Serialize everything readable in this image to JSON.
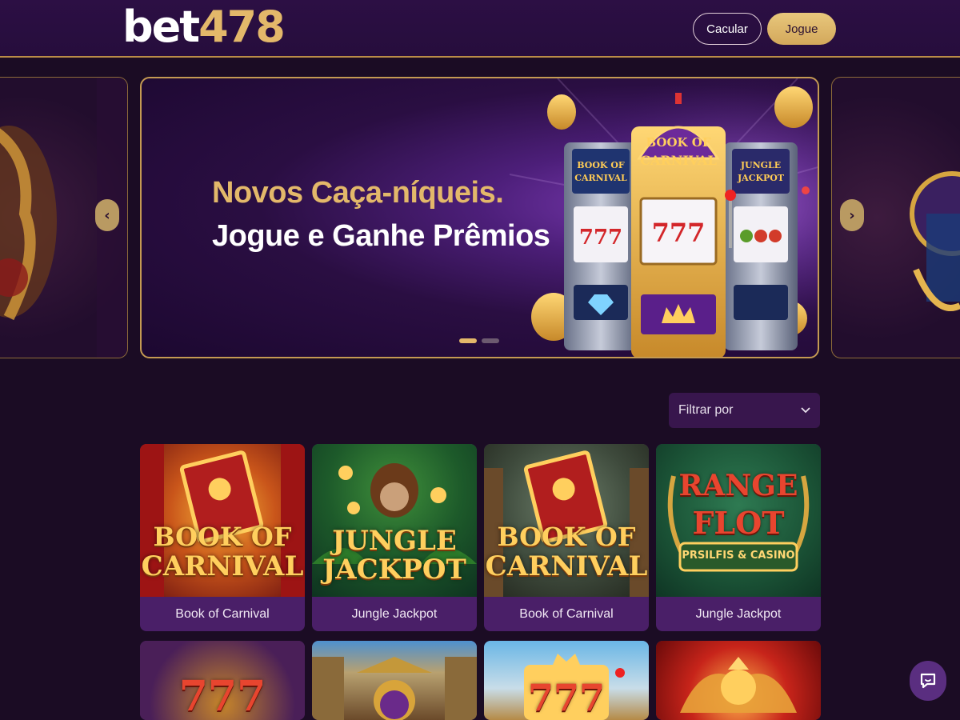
{
  "header": {
    "logo_part1": "bet",
    "logo_part2": "478",
    "login_label": "Cacular",
    "play_label": "Jogue"
  },
  "banner": {
    "title_line1": "Novos Caça-níqueis.",
    "title_line2": "Jogue e Ganhe Prêmios",
    "machine_left_label": "BOOK OF CARNIVAL",
    "machine_center_label_1": "BOOK OF",
    "machine_center_label_2": "CARNIVAL",
    "machine_right_label": "JUNGLE JACKPOT",
    "reel_symbols": "777",
    "active_slide_index": 0,
    "slide_count": 2
  },
  "filter": {
    "label": "Filtrar por"
  },
  "games": [
    {
      "name": "Book of Carnival",
      "art_line1": "BOOK OF",
      "art_line2": "CARNIVAL",
      "theme": "carnival"
    },
    {
      "name": "Jungle Jackpot",
      "art_line1": "JUNGLE",
      "art_line2": "JACKPOT",
      "theme": "jungle"
    },
    {
      "name": "Book of Carnival",
      "art_line1": "BOOK OF",
      "art_line2": "CARNIVAL",
      "theme": "carnival2"
    },
    {
      "name": "Jungle Jackpot",
      "art_line1": "RANGE",
      "art_line2": "FLOT",
      "art_line3": "PRSILFIS & CASINO",
      "theme": "range"
    }
  ],
  "games_row2": [
    {
      "art_text": "777",
      "theme": "777-red"
    },
    {
      "art_text": "",
      "theme": "temple"
    },
    {
      "art_text": "777",
      "theme": "777-blue"
    },
    {
      "art_text": "",
      "theme": "phoenix"
    }
  ],
  "colors": {
    "gold": "#e3b86a",
    "purple_bg": "#1b0c24",
    "card_bg": "#4a1f68"
  }
}
